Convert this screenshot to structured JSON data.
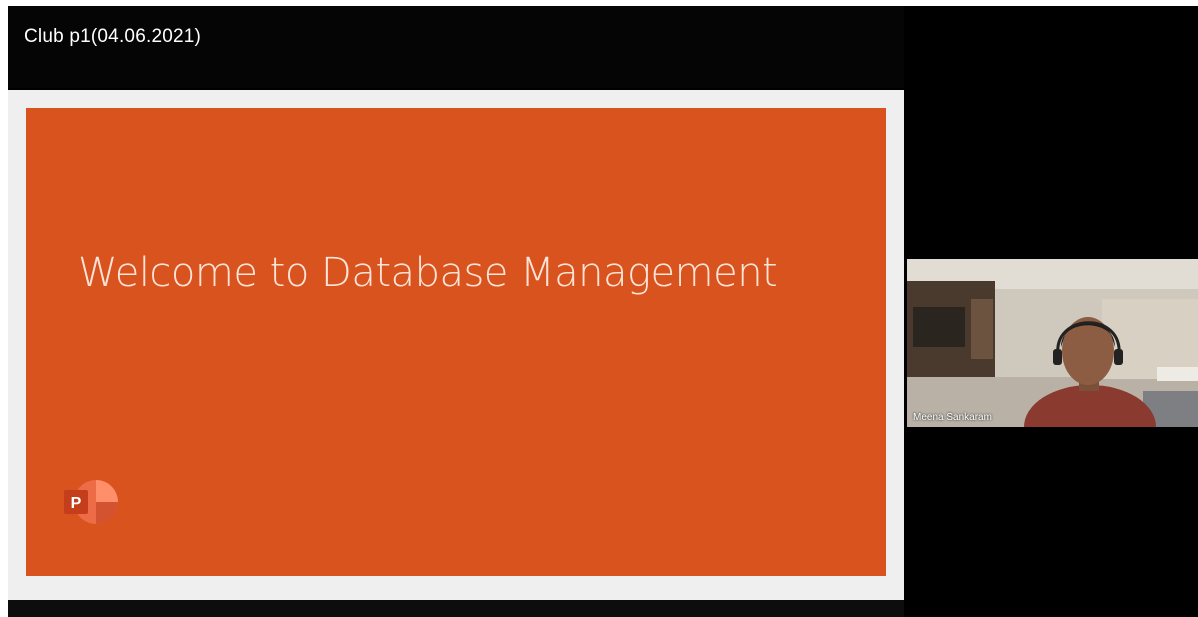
{
  "meeting": {
    "title": "Club p1(04.06.2021)"
  },
  "slide": {
    "title": "Welcome to Database Management",
    "app_icon": "powerpoint-icon",
    "accent_color": "#d9531e"
  },
  "participant": {
    "name": "Meena Sankaram"
  }
}
